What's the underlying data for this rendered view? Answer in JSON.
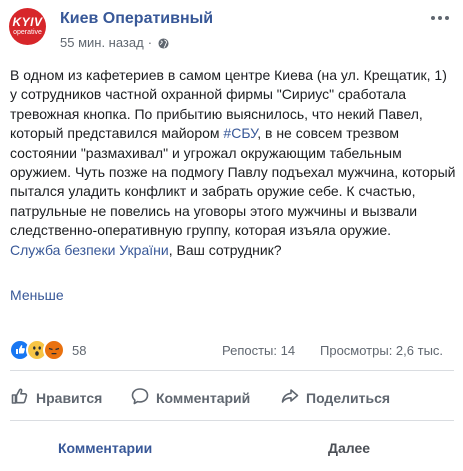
{
  "header": {
    "logo_text": "KYIV",
    "logo_subtext": "operative",
    "page_name": "Киев Оперативный",
    "timestamp": "55 мин. назад",
    "separator": "·",
    "privacy_icon": "globe-icon",
    "more_icon": "more-dots-icon"
  },
  "post": {
    "text_before_tag": "В одном из кафетериев в самом центре Киева (на ул. Крещатик, 1) у сотрудников частной охранной фирмы \"Сириус\" сработала тревожная кнопка. По прибытию выяснилось, что некий Павел, который представился майором ",
    "hashtag": "#СБУ",
    "text_after_tag": ", в не совсем трезвом состоянии \"размахивал\" и угрожал окружающим табельным оружием. Чуть позже на подмогу Павлу подъехал мужчина, который пытался уладить конфликт и забрать оружие себе. К счастью, патрульные не повелись на уговоры этого мужчины и вызвали следственно-оперативную группу, которая изъяла оружие.",
    "mention": "Служба безпеки України",
    "mention_suffix": ", Ваш сотрудник?",
    "less_label": "Меньше"
  },
  "stats": {
    "reaction_icons": [
      "like-reaction-icon",
      "wow-reaction-icon",
      "angry-reaction-icon"
    ],
    "reaction_count": "58",
    "shares": "Репосты: 14",
    "views": "Просмотры: 2,6 тыс."
  },
  "actions": {
    "like_label": "Нравится",
    "comment_label": "Комментарий",
    "share_label": "Поделиться"
  },
  "bottom": {
    "comments_label": "Комментарии",
    "next_label": "Далее"
  },
  "colors": {
    "link": "#385898",
    "secondary_text": "#606770",
    "divider": "#dadde1",
    "logo_red": "#d7262a"
  }
}
